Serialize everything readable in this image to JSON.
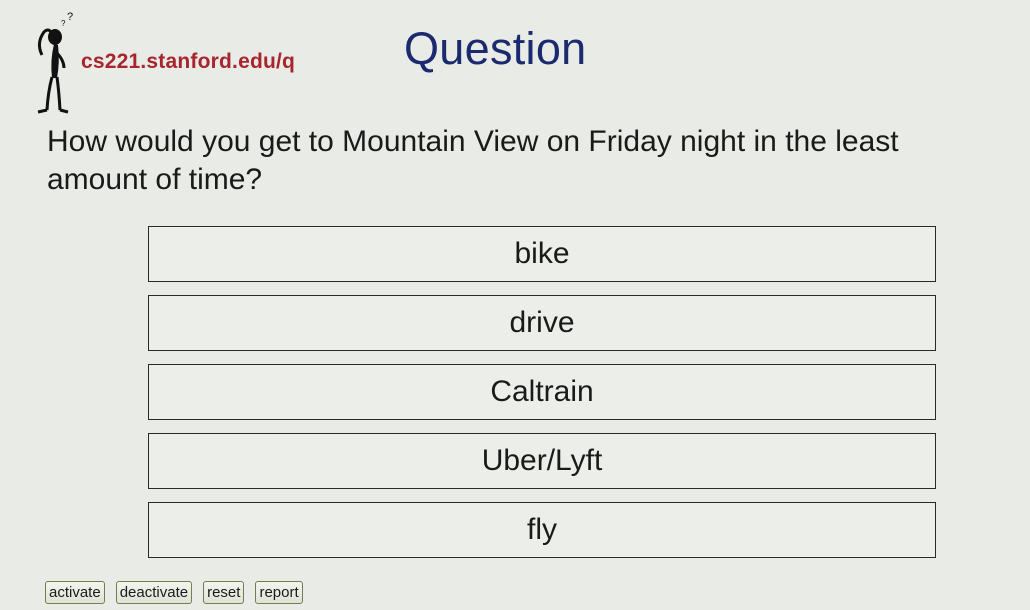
{
  "header": {
    "site_url": "cs221.stanford.edu/q",
    "title": "Question",
    "logo_icon": "thinking-figure-icon"
  },
  "question": {
    "text": "How would you get to Mountain View on Friday night in the least amount of time?"
  },
  "options": [
    {
      "label": "bike"
    },
    {
      "label": "drive"
    },
    {
      "label": "Caltrain"
    },
    {
      "label": "Uber/Lyft"
    },
    {
      "label": "fly"
    }
  ],
  "controls": {
    "activate": "activate",
    "deactivate": "deactivate",
    "reset": "reset",
    "report": "report"
  },
  "colors": {
    "background": "#e9ebe6",
    "url_text": "#a8252e",
    "title_text": "#1b2a6e"
  }
}
